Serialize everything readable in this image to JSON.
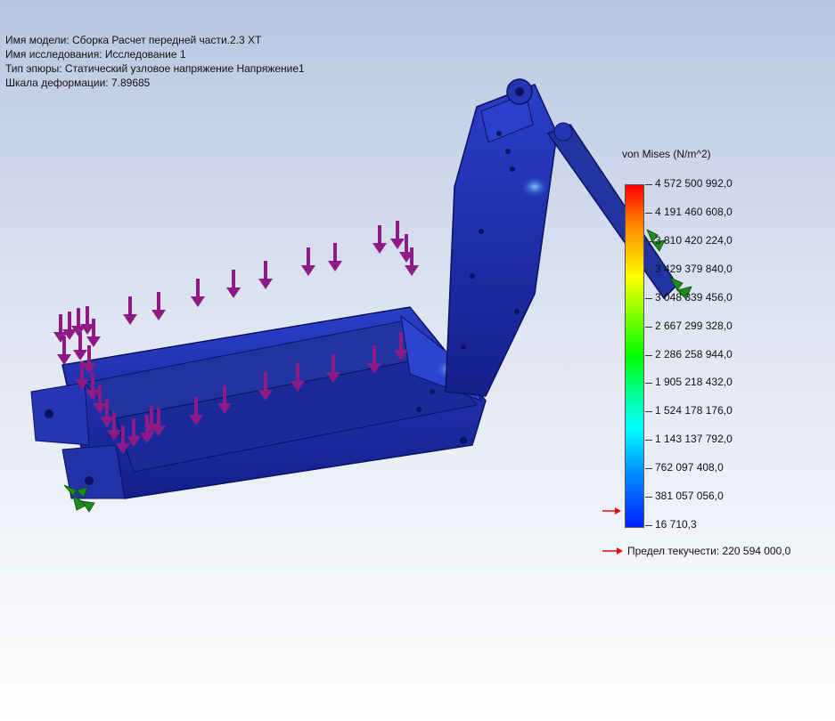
{
  "info": {
    "model_name": "Имя модели: Сборка Расчет передней части.2.3 ХТ",
    "study_name": "Имя  исследования: Исследование 1",
    "plot_type": "Тип эпюры: Статический узловое напряжение Напряжение1",
    "deformation_scale": "Шкала деформации: 7.89685"
  },
  "legend": {
    "title": "von Mises (N/m^2)",
    "ticks": [
      "4 572 500 992,0",
      "4 191 460 608,0",
      "3 810 420 224,0",
      "3 429 379 840,0",
      "3 048 339 456,0",
      "2 667 299 328,0",
      "2 286 258 944,0",
      "1 905 218 432,0",
      "1 524 178 176,0",
      "1 143 137 792,0",
      "762 097 408,0",
      "381 057 056,0",
      "16 710,3"
    ],
    "yield_label": "Предел текучести: 220 594 000,0"
  },
  "colors": {
    "part_blue": "#1f2fb0",
    "load_arrow": "#8e1a86",
    "fixture": "#1f8a1f",
    "yield_marker": "#e01010"
  }
}
